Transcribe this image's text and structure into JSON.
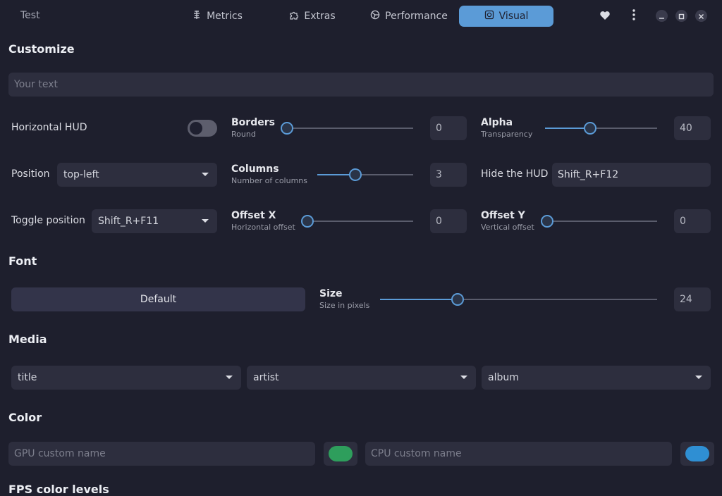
{
  "header": {
    "app_title": "Test",
    "tabs": [
      {
        "label": "Metrics",
        "icon": "metrics-icon",
        "active": false
      },
      {
        "label": "Extras",
        "icon": "puzzle-icon",
        "active": false
      },
      {
        "label": "Performance",
        "icon": "gauge-icon",
        "active": false
      },
      {
        "label": "Visual",
        "icon": "visual-icon",
        "active": true
      }
    ]
  },
  "customize": {
    "title": "Customize",
    "text_placeholder": "Your text",
    "horizontal_hud": {
      "label": "Horizontal HUD",
      "enabled": false
    },
    "borders": {
      "label": "Borders",
      "sub": "Round",
      "value": "0",
      "fraction": 0.0
    },
    "alpha": {
      "label": "Alpha",
      "sub": "Transparency",
      "value": "40",
      "fraction": 0.4
    },
    "position": {
      "label": "Position",
      "selected": "top-left"
    },
    "columns": {
      "label": "Columns",
      "sub": "Number of columns",
      "value": "3",
      "fraction": 0.4
    },
    "hide_hud": {
      "label": "Hide the HUD",
      "value": "Shift_R+F12"
    },
    "toggle_position": {
      "label": "Toggle position",
      "selected": "Shift_R+F11"
    },
    "offset_x": {
      "label": "Offset X",
      "sub": "Horizontal offset",
      "value": "0",
      "fraction": 0.0
    },
    "offset_y": {
      "label": "Offset Y",
      "sub": "Vertical offset",
      "value": "0",
      "fraction": 0.0
    }
  },
  "font": {
    "title": "Font",
    "default_button": "Default",
    "size": {
      "label": "Size",
      "sub": "Size in pixels",
      "value": "24",
      "fraction": 0.28
    }
  },
  "media": {
    "title": "Media",
    "fields": [
      "title",
      "artist",
      "album"
    ]
  },
  "color": {
    "title": "Color",
    "gpu_placeholder": "GPU custom name",
    "cpu_placeholder": "CPU custom name",
    "gpu_color": "#2e9e5c",
    "cpu_color": "#2f8fd3"
  },
  "fps_color_levels": {
    "title": "FPS color levels"
  },
  "colors": {
    "accent": "#5b9bd7",
    "background": "#1e1f2d",
    "surface": "#2d2e3e"
  }
}
